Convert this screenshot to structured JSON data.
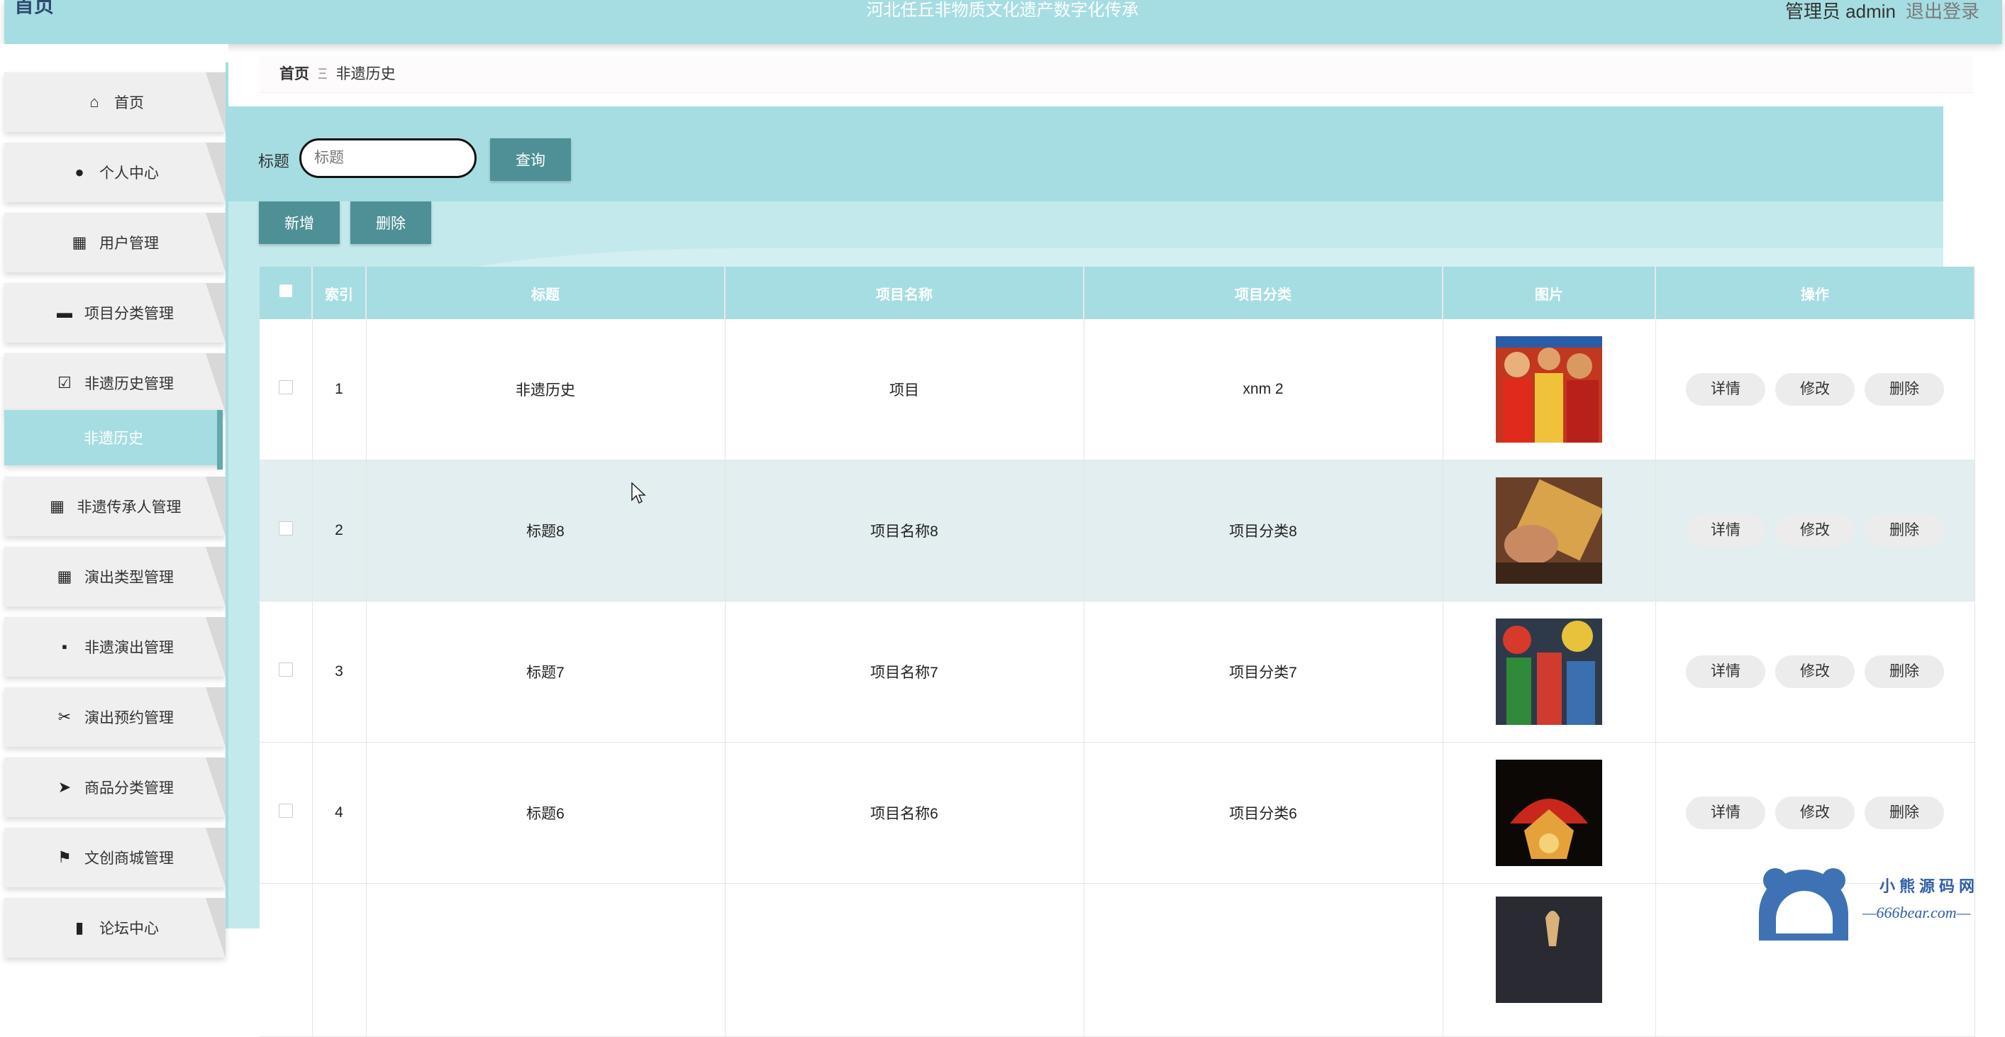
{
  "header": {
    "logo": "首页",
    "title": "河北任丘非物质文化遗产数字化传承",
    "user": "管理员 admin",
    "logout": "退出登录"
  },
  "sidebar": {
    "items": [
      {
        "label": "首页",
        "icon": "home-icon",
        "glyph": "⌂"
      },
      {
        "label": "个人中心",
        "icon": "user-icon",
        "glyph": "●"
      },
      {
        "label": "用户管理",
        "icon": "grid-icon",
        "glyph": "▦"
      },
      {
        "label": "项目分类管理",
        "icon": "monitor-icon",
        "glyph": "▬"
      },
      {
        "label": "非遗历史管理",
        "icon": "clipboard-icon",
        "glyph": "☑"
      },
      {
        "label": "非遗历史",
        "icon": "",
        "glyph": ""
      },
      {
        "label": "非遗传承人管理",
        "icon": "grid-icon",
        "glyph": "▦"
      },
      {
        "label": "演出类型管理",
        "icon": "grid-icon",
        "glyph": "▦"
      },
      {
        "label": "非遗演出管理",
        "icon": "message-icon",
        "glyph": "▪"
      },
      {
        "label": "演出预约管理",
        "icon": "ticket-icon",
        "glyph": "✂"
      },
      {
        "label": "商品分类管理",
        "icon": "send-icon",
        "glyph": "➤"
      },
      {
        "label": "文创商城管理",
        "icon": "flag-icon",
        "glyph": "⚑"
      },
      {
        "label": "论坛中心",
        "icon": "chart-icon",
        "glyph": "▮"
      }
    ]
  },
  "breadcrumb": {
    "home": "首页",
    "sep": "Ξ",
    "current": "非遗历史"
  },
  "search": {
    "label": "标题",
    "placeholder": "标题",
    "button": "查询"
  },
  "actions": {
    "add": "新增",
    "delete": "删除"
  },
  "table": {
    "headers": [
      "索引",
      "标题",
      "项目名称",
      "项目分类",
      "图片",
      "操作"
    ],
    "rows": [
      {
        "index": "1",
        "title": "非遗历史",
        "project": "项目",
        "category": "xnm 2"
      },
      {
        "index": "2",
        "title": "标题8",
        "project": "项目名称8",
        "category": "项目分类8"
      },
      {
        "index": "3",
        "title": "标题7",
        "project": "项目名称7",
        "category": "项目分类7"
      },
      {
        "index": "4",
        "title": "标题6",
        "project": "项目名称6",
        "category": "项目分类6"
      }
    ],
    "ops": {
      "detail": "详情",
      "edit": "修改",
      "delete": "删除"
    }
  },
  "watermark": {
    "line1": "小熊源码网",
    "line2": "—666bear.com—"
  },
  "colors": {
    "accent": "#a6dde2",
    "button": "#4f9097",
    "active": "#a6dde2"
  }
}
